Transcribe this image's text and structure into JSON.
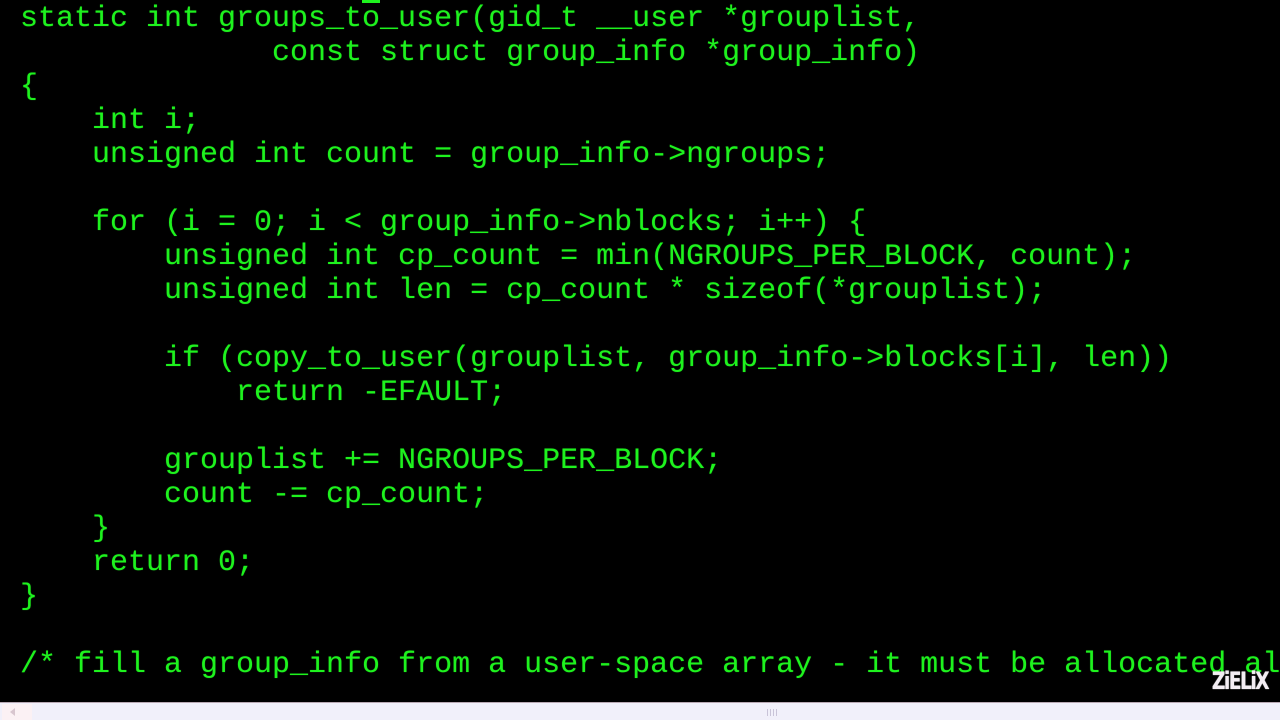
{
  "editor": {
    "theme": {
      "background": "#000000",
      "text_color": "#1ef21e"
    },
    "code_lines": [
      "static int groups_to_user(gid_t __user *grouplist,",
      "              const struct group_info *group_info)",
      "{",
      "    int i;",
      "    unsigned int count = group_info->ngroups;",
      "",
      "    for (i = 0; i < group_info->nblocks; i++) {",
      "        unsigned int cp_count = min(NGROUPS_PER_BLOCK, count);",
      "        unsigned int len = cp_count * sizeof(*grouplist);",
      "",
      "        if (copy_to_user(grouplist, group_info->blocks[i], len))",
      "            return -EFAULT;",
      "",
      "        grouplist += NGROUPS_PER_BLOCK;",
      "        count -= cp_count;",
      "    }",
      "    return 0;",
      "}",
      "",
      "/* fill a group_info from a user-space array - it must be allocated al"
    ]
  },
  "watermark": {
    "text": "ZiELiX",
    "color": "#f4eef4"
  },
  "scrollbar": {
    "orientation": "horizontal",
    "left_button_icon": "arrow-left-icon",
    "grip_icon": "grip-icon"
  }
}
